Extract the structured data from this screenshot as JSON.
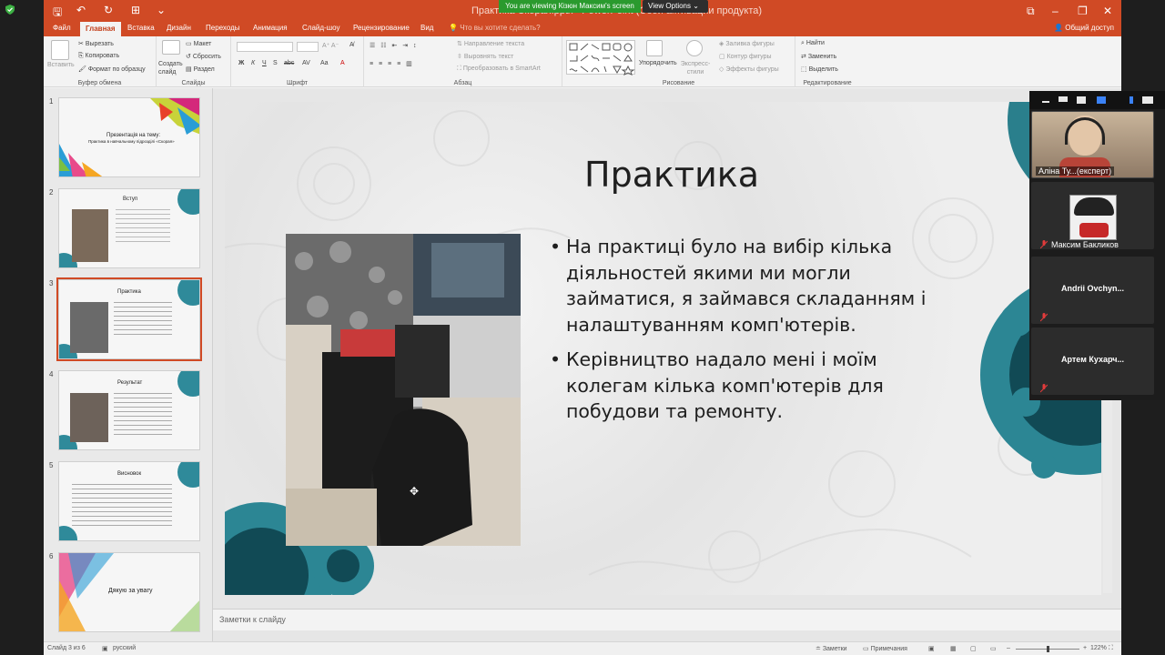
{
  "zoom_overlay": {
    "viewing_banner": "You are viewing Кізюн Максим's screen",
    "view_options": "View Options ⌄",
    "participants": [
      {
        "name": "Аліна Ту...(експерт)"
      },
      {
        "name": "Максим Бакликов"
      },
      {
        "name": "Andrii Ovchyn..."
      },
      {
        "name": "Артем Кухарч..."
      }
    ]
  },
  "window": {
    "title": "Практика Скорая.pptx - PowerPoint (Сбой активации продукта)",
    "share": "Общий доступ"
  },
  "tabs": [
    "Файл",
    "Главная",
    "Вставка",
    "Дизайн",
    "Переходы",
    "Анимация",
    "Слайд-шоу",
    "Рецензирование",
    "Вид"
  ],
  "search_hint": "Что вы хотите сделать?",
  "ribbon": {
    "clipboard": {
      "paste": "Вставить",
      "cut": "Вырезать",
      "copy": "Копировать",
      "format": "Формат по образцу",
      "label": "Буфер обмена"
    },
    "slides": {
      "create": "Создать слайд",
      "layout": "Макет",
      "reset": "Сбросить",
      "section": "Раздел",
      "label": "Слайды"
    },
    "font": {
      "label": "Шрифт",
      "buttons": [
        "Ж",
        "К",
        "Ч",
        "S",
        "abc",
        "AV",
        "Aa",
        "A"
      ]
    },
    "paragraph": {
      "direction": "Направление текста",
      "align": "Выровнять текст",
      "smartart": "Преобразовать в SmartArt",
      "label": "Абзац"
    },
    "drawing": {
      "arrange": "Упорядочить",
      "quick_styles": "Экспресс-стили",
      "fill": "Заливка фигуры",
      "outline": "Контур фигуры",
      "effects": "Эффекты фигуры",
      "label": "Рисование"
    },
    "editing": {
      "find": "Найти",
      "replace": "Заменить",
      "select": "Выделить",
      "label": "Редактирование"
    }
  },
  "thumbnails": [
    {
      "num": "1",
      "title": "Презентація на тему:",
      "subtitle": "Практика в навчальному підрозділі «Скорая»"
    },
    {
      "num": "2",
      "title": "Вступ"
    },
    {
      "num": "3",
      "title": "Практика"
    },
    {
      "num": "4",
      "title": "Результат"
    },
    {
      "num": "5",
      "title": "Висновок"
    },
    {
      "num": "6",
      "title": "Дякую за увагу"
    }
  ],
  "slide": {
    "title": "Практика",
    "bullets": [
      "На практиці було на вибір кілька діяльностей якими ми могли займатися, я займався складанням і налаштуванням комп'ютерів.",
      "Керівництво надало мені і моїм колегам кілька комп'ютерів для побудови та ремонту."
    ]
  },
  "notes_placeholder": "Заметки к слайду",
  "status": {
    "slide_of": "Слайд 3 из 6",
    "language": "русский",
    "notes": "Заметки",
    "comments": "Примечания",
    "zoom": "122%"
  },
  "colors": {
    "accent": "#d04a25",
    "teal_gear": "#2f8a9a",
    "zoom_green": "#2a9a2e"
  }
}
